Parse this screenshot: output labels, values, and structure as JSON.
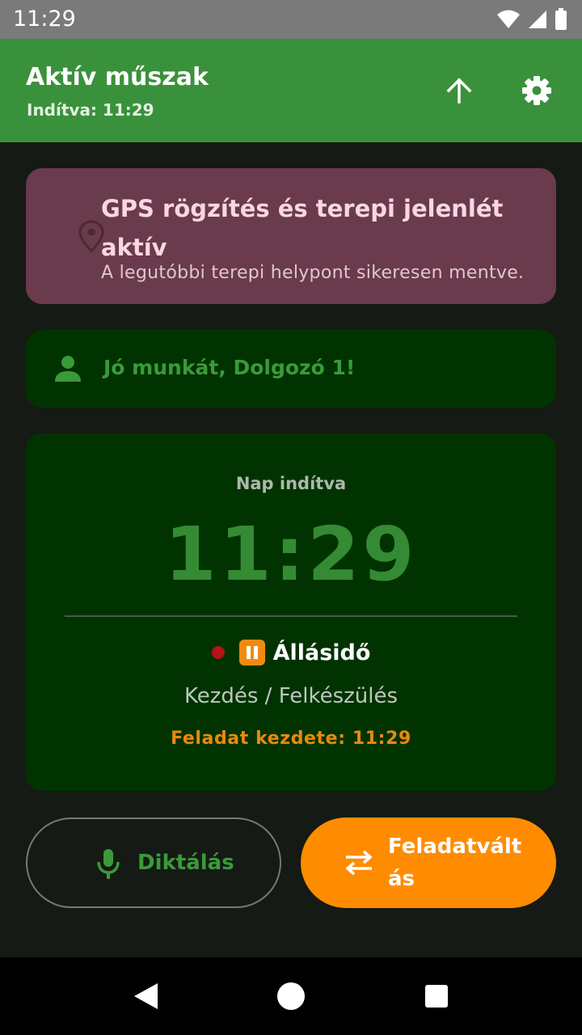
{
  "status_bar": {
    "time": "11:29"
  },
  "app_bar": {
    "title": "Aktív műszak",
    "subtitle": "Indítva: 11:29"
  },
  "gps_card": {
    "title": "GPS rögzítés és terepi jelenlét aktív",
    "subtitle": "A legutóbbi terepi helypont sikeresen mentve."
  },
  "greeting": {
    "text": "Jó munkát, Dolgozó 1!"
  },
  "shift_card": {
    "label": "Nap indítva",
    "clock": "11:29",
    "state": "Állásidő",
    "task": "Kezdés / Felkészülés",
    "task_start": "Feladat kezdete: 11:29"
  },
  "actions": {
    "dictate_label": "Diktálás",
    "switch_label": "Feladatváltás"
  },
  "colors": {
    "app_bar": "#3a913b",
    "accent_orange": "#ff8c00",
    "green_text": "#3a9a3a",
    "gps_card": "#6a3a4d",
    "card_bg": "#003300",
    "record_dot": "#b31414"
  },
  "icons": {
    "upload": "arrow-up-icon",
    "settings": "gear-icon",
    "location": "location-pin-icon",
    "person": "person-icon",
    "mic": "microphone-icon",
    "swap": "swap-arrows-icon"
  }
}
